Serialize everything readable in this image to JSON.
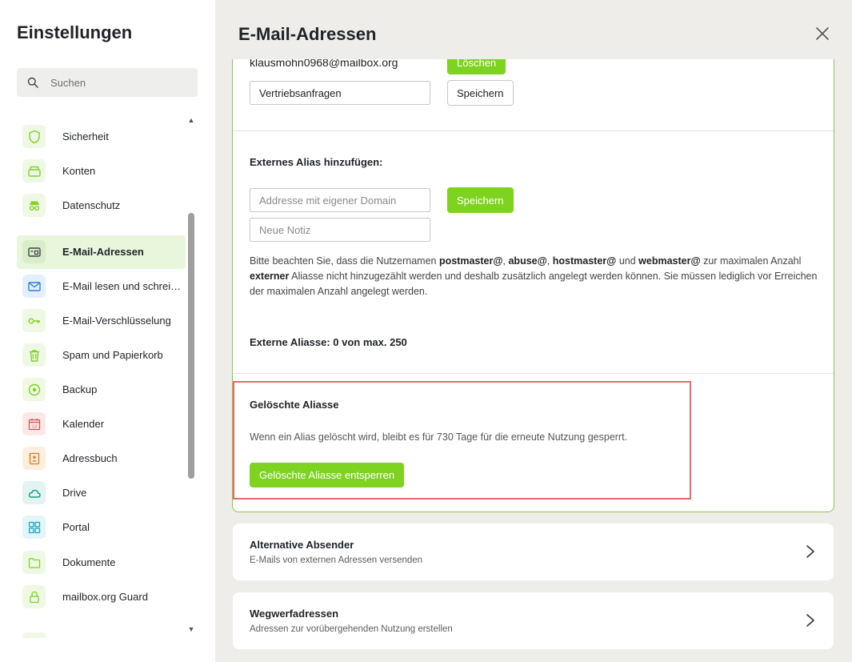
{
  "sidebar": {
    "title": "Einstellungen",
    "search_placeholder": "Suchen",
    "items": [
      {
        "label": "Sicherheit",
        "icon": "shield-icon",
        "color": "#7ed321"
      },
      {
        "label": "Konten",
        "icon": "accounts-icon",
        "color": "#7ed321"
      },
      {
        "label": "Datenschutz",
        "icon": "spy-icon",
        "color": "#7ed321"
      },
      {
        "label": "E-Mail-Adressen",
        "icon": "address-card-icon",
        "color": "#555555",
        "active": true
      },
      {
        "label": "E-Mail lesen und schreiben",
        "icon": "envelope-icon",
        "color": "#2f7ed8"
      },
      {
        "label": "E-Mail-Verschlüsselung",
        "icon": "key-icon",
        "color": "#7ed321"
      },
      {
        "label": "Spam und Papierkorb",
        "icon": "trash-icon",
        "color": "#7ed321"
      },
      {
        "label": "Backup",
        "icon": "backup-icon",
        "color": "#7ed321"
      },
      {
        "label": "Kalender",
        "icon": "calendar-icon",
        "color": "#d9534f"
      },
      {
        "label": "Adressbuch",
        "icon": "addressbook-icon",
        "color": "#e67e22"
      },
      {
        "label": "Drive",
        "icon": "cloud-icon",
        "color": "#16a085"
      },
      {
        "label": "Portal",
        "icon": "grid-icon",
        "color": "#17a2b8"
      },
      {
        "label": "Dokumente",
        "icon": "folder-icon",
        "color": "#7ed321"
      },
      {
        "label": "mailbox.org Guard",
        "icon": "lock-icon",
        "color": "#7ed321"
      }
    ]
  },
  "main": {
    "title": "E-Mail-Adressen",
    "close_icon": "close-icon",
    "alias_row": {
      "address": "klausmohn0968@mailbox.org",
      "delete_label": "Löschen",
      "note_value": "Vertriebsanfragen",
      "save_label": "Speichern"
    },
    "external_alias": {
      "heading": "Externes Alias hinzufügen:",
      "address_placeholder": "Addresse mit eigener Domain",
      "note_placeholder": "Neue Notiz",
      "save_label": "Speichern",
      "note_parts": {
        "p1": "Bitte beachten Sie, dass die Nutzernamen ",
        "b1": "postmaster@",
        "p2": ", ",
        "b2": "abuse@",
        "p3": ", ",
        "b3": "hostmaster@",
        "p4": " und ",
        "b4": "webmaster@",
        "p5": " zur maximalen Anzahl ",
        "b5": "externer",
        "p6": " Aliasse nicht hinzugezählt werden und deshalb zusätzlich angelegt werden können. Sie müssen lediglich vor Erreichen der maximalen Anzahl angelegt werden."
      },
      "count_label": "Externe Aliasse: 0 von max. 250"
    },
    "deleted_aliases": {
      "heading": "Gelöschte Aliasse",
      "text": "Wenn ein Alias gelöscht wird, bleibt es für 730 Tage für die erneute Nutzung gesperrt.",
      "button_label": "Gelöschte Aliasse entsperren"
    },
    "cards": [
      {
        "title": "Alternative Absender",
        "subtitle": "E-Mails von externen Adressen versenden"
      },
      {
        "title": "Wegwerfadressen",
        "subtitle": "Adressen zur vorübergehenden Nutzung erstellen"
      }
    ]
  },
  "colors": {
    "accent": "#7ed321",
    "active_bg": "#e8f6dc",
    "highlight_border": "#e56a6a"
  }
}
